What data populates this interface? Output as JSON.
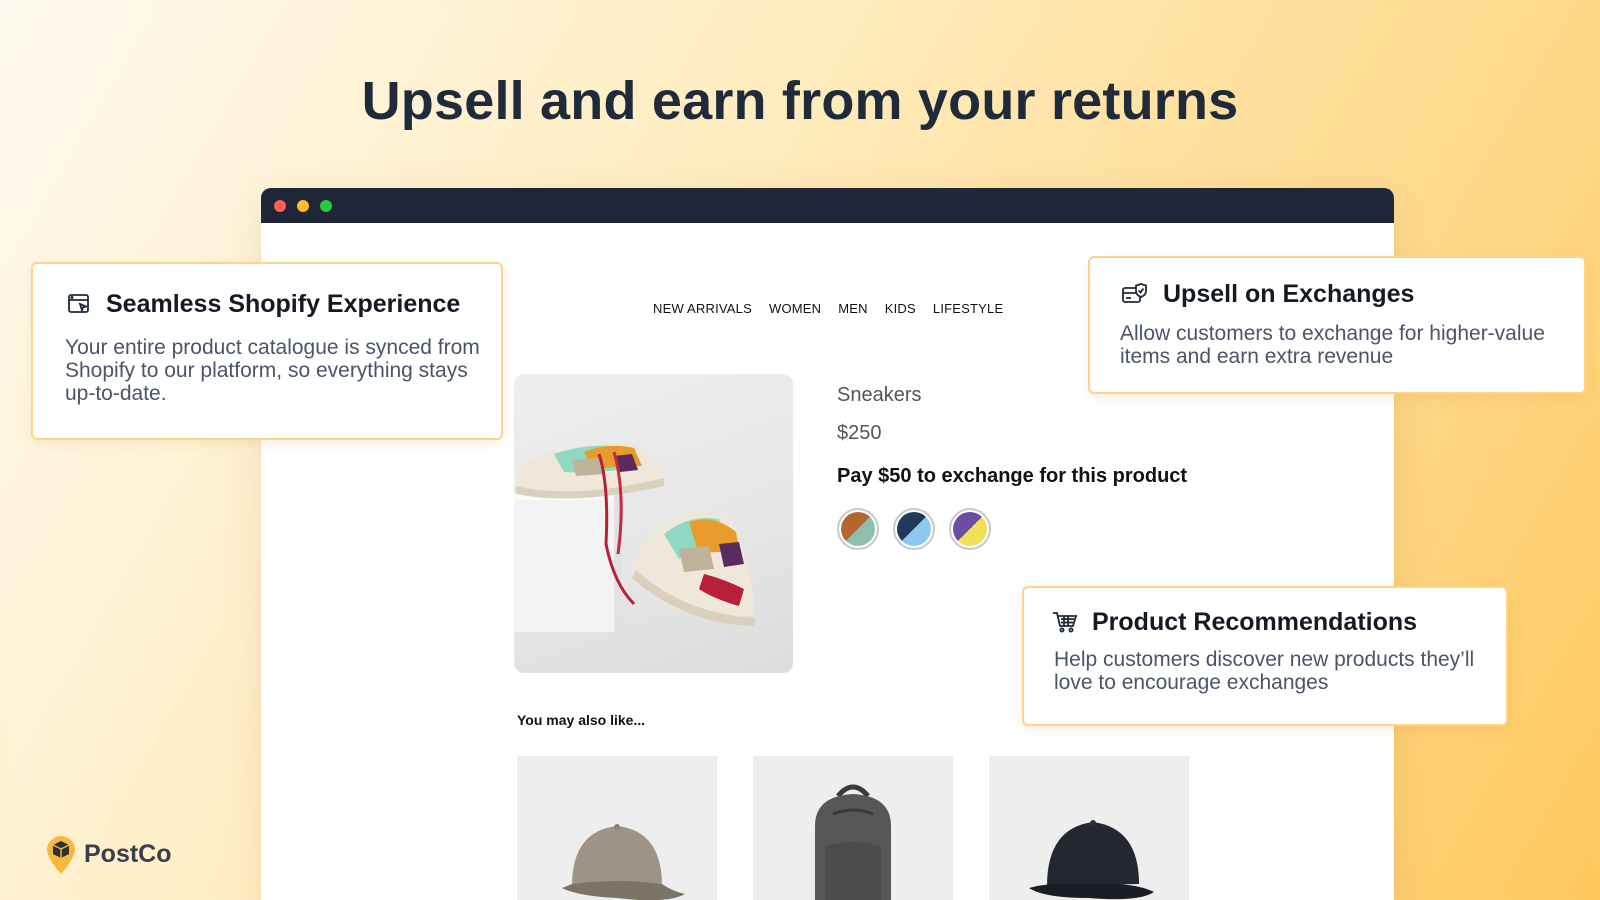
{
  "headline": "Upsell and earn from your returns",
  "nav": [
    "NEW ARRIVALS",
    "WOMEN",
    "MEN",
    "KIDS",
    "LIFESTYLE"
  ],
  "product": {
    "name": "Sneakers",
    "price": "$250",
    "offer": "Pay $50 to exchange for this product",
    "swatches": [
      {
        "a": "#b5652e",
        "b": "#8fbfae"
      },
      {
        "a": "#1f3b58",
        "b": "#8dc9ef"
      },
      {
        "a": "#6a4ea6",
        "b": "#f2e05a"
      }
    ]
  },
  "recommendations": {
    "heading": "You may also like...",
    "items": [
      "beige cap",
      "grey backpack",
      "black cap"
    ]
  },
  "features": {
    "shopify": {
      "icon": "browser-cursor-icon",
      "title": "Seamless Shopify Experience",
      "body": "Your entire product catalogue is synced from Shopify to our platform, so everything stays up-to-date."
    },
    "exchanges": {
      "icon": "verified-card-icon",
      "title": "Upsell on Exchanges",
      "body": "Allow customers to exchange for higher-value items and earn extra revenue"
    },
    "recommendations": {
      "icon": "cart-icon",
      "title": "Product Recommendations",
      "body": "Help customers discover new products they’ll love to encourage exchanges"
    }
  },
  "brand": {
    "name": "PostCo",
    "accent": "#f5b93c"
  }
}
